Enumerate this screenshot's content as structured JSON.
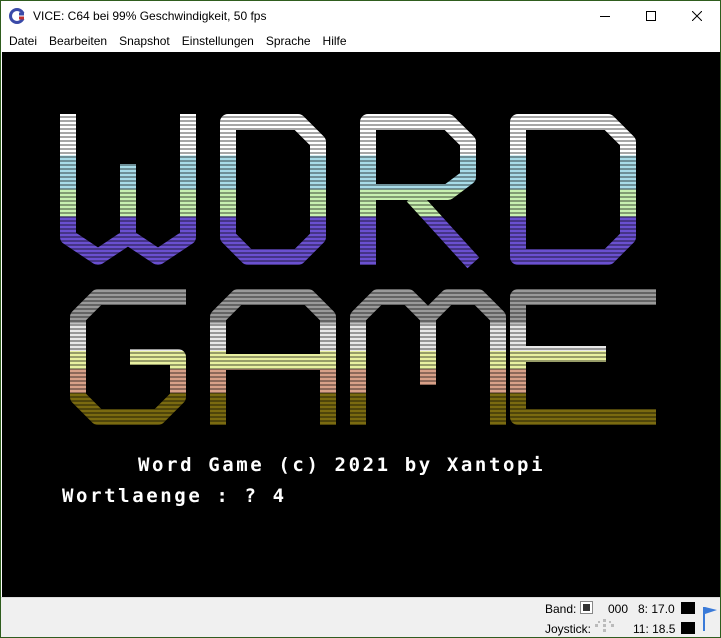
{
  "window": {
    "title": "VICE: C64 bei 99% Geschwindigkeit, 50 fps"
  },
  "menu": {
    "items": [
      {
        "label": "Datei"
      },
      {
        "label": "Bearbeiten"
      },
      {
        "label": "Snapshot"
      },
      {
        "label": "Einstellungen"
      },
      {
        "label": "Sprache"
      },
      {
        "label": "Hilfe"
      }
    ]
  },
  "screen": {
    "logo_line1": "WORD",
    "logo_line2": "GAME",
    "credit": "Word Game (c) 2021 by Xantopi",
    "prompt": "Wortlaenge : ? 4",
    "logo_colors": {
      "white": "#ffffff",
      "cyan": "#a8dce8",
      "lightgreen": "#c8f0b0",
      "purple": "#6a50d0",
      "gray": "#9a9a9a",
      "lightgray": "#e8e8e8",
      "yellow": "#e8f0a0",
      "salmon": "#d8a088",
      "brown": "#a87040",
      "olive": "#7a6a10"
    }
  },
  "status": {
    "tape_label": "Band:",
    "tape_counter": "000",
    "drive8": "8: 17.0",
    "joystick_label": "Joystick:",
    "drive11": "11: 18.5"
  }
}
